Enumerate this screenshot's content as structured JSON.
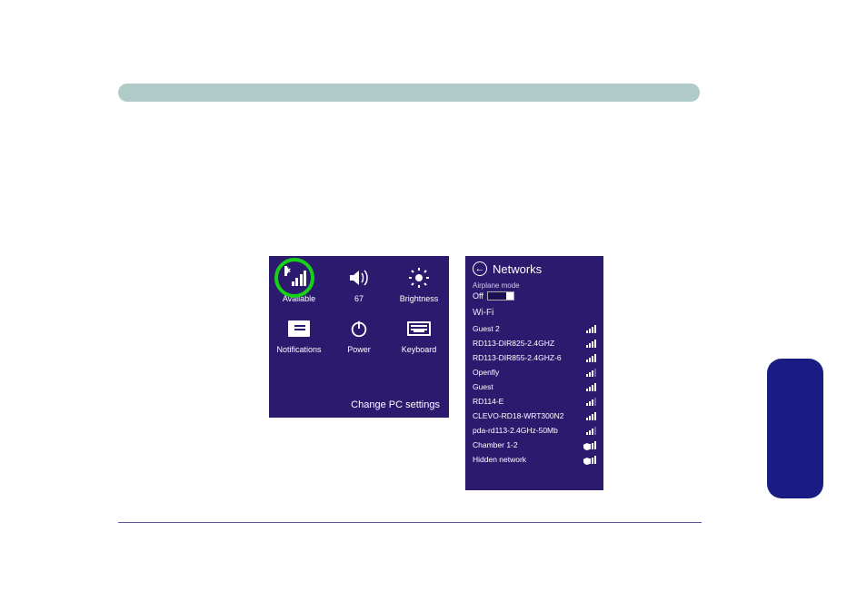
{
  "settings": {
    "tiles_row1": [
      {
        "id": "network",
        "label": "Available",
        "icon": "network-available-icon"
      },
      {
        "id": "volume",
        "label": "67",
        "icon": "volume-icon"
      },
      {
        "id": "brightness",
        "label": "Brightness",
        "icon": "brightness-icon"
      }
    ],
    "tiles_row2": [
      {
        "id": "notifications",
        "label": "Notifications",
        "icon": "notifications-icon"
      },
      {
        "id": "power",
        "label": "Power",
        "icon": "power-icon"
      },
      {
        "id": "keyboard",
        "label": "Keyboard",
        "icon": "keyboard-icon"
      }
    ],
    "change_label": "Change PC settings"
  },
  "networks": {
    "title": "Networks",
    "airplane_label": "Airplane mode",
    "airplane_state": "Off",
    "wifi_label": "Wi-Fi",
    "list": [
      {
        "name": "Guest 2",
        "strength": 4,
        "secure": false
      },
      {
        "name": "RD113-DIR825-2.4GHZ",
        "strength": 4,
        "secure": false
      },
      {
        "name": "RD113-DIR855-2.4GHZ-6",
        "strength": 4,
        "secure": false
      },
      {
        "name": "Openfly",
        "strength": 3,
        "secure": false
      },
      {
        "name": "Guest",
        "strength": 4,
        "secure": false
      },
      {
        "name": "RD114-E",
        "strength": 3,
        "secure": false
      },
      {
        "name": "CLEVO-RD18-WRT300N2",
        "strength": 4,
        "secure": false
      },
      {
        "name": "pda-rd113-2.4GHz-50Mb",
        "strength": 3,
        "secure": false
      },
      {
        "name": "Chamber 1-2",
        "strength": 4,
        "secure": true
      },
      {
        "name": "Hidden network",
        "strength": 4,
        "secure": true
      }
    ]
  }
}
